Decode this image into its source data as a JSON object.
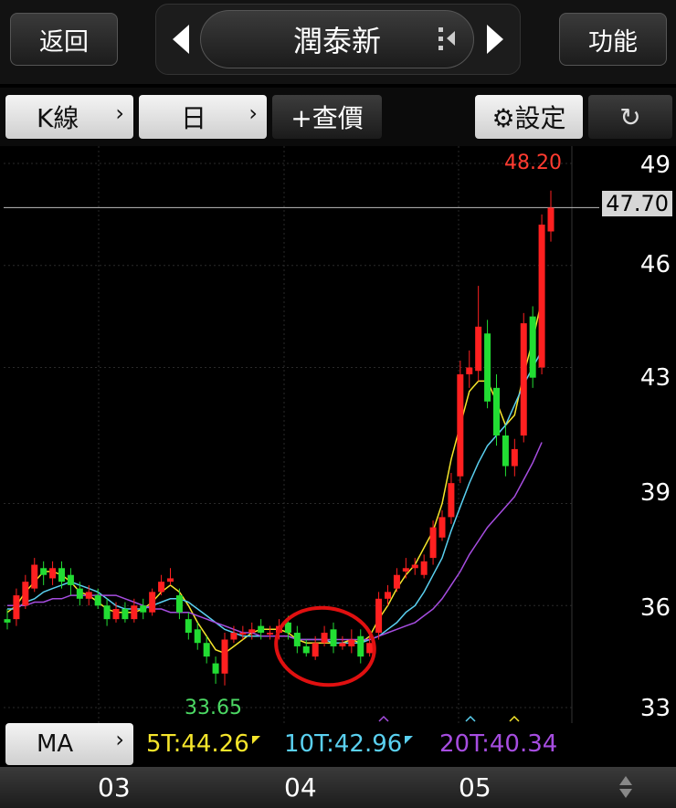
{
  "header": {
    "back_label": "返回",
    "title": "潤泰新",
    "menu_label": "功能"
  },
  "toolbar": {
    "chart_type_label": "K線",
    "period_label": "日",
    "lookup_label": "+查價",
    "settings_label": "⚙設定"
  },
  "chart_data": {
    "type": "candlestick",
    "y_ticks": [
      "49",
      "46",
      "43",
      "39",
      "36",
      "33"
    ],
    "ylim": [
      32.5,
      49.5
    ],
    "x_ticks": [
      "03",
      "04",
      "05"
    ],
    "max_label": "48.20",
    "min_label": "33.65",
    "current_price": "47.70",
    "candles": [
      {
        "o": 35.6,
        "c": 35.5,
        "h": 35.9,
        "l": 35.3
      },
      {
        "o": 35.6,
        "c": 36.3,
        "h": 36.5,
        "l": 35.4
      },
      {
        "o": 36.0,
        "c": 36.7,
        "h": 36.9,
        "l": 35.9
      },
      {
        "o": 36.5,
        "c": 37.2,
        "h": 37.4,
        "l": 36.4
      },
      {
        "o": 37.1,
        "c": 36.9,
        "h": 37.3,
        "l": 36.6
      },
      {
        "o": 36.8,
        "c": 37.1,
        "h": 37.3,
        "l": 36.6
      },
      {
        "o": 37.1,
        "c": 36.7,
        "h": 37.3,
        "l": 36.5
      },
      {
        "o": 36.9,
        "c": 36.6,
        "h": 37.1,
        "l": 36.3
      },
      {
        "o": 36.5,
        "c": 36.2,
        "h": 36.7,
        "l": 36.0
      },
      {
        "o": 36.2,
        "c": 36.4,
        "h": 36.6,
        "l": 36.0
      },
      {
        "o": 36.3,
        "c": 36.0,
        "h": 36.5,
        "l": 35.9
      },
      {
        "o": 36.0,
        "c": 35.6,
        "h": 36.2,
        "l": 35.4
      },
      {
        "o": 35.6,
        "c": 35.9,
        "h": 36.1,
        "l": 35.5
      },
      {
        "o": 35.9,
        "c": 35.6,
        "h": 36.1,
        "l": 35.5
      },
      {
        "o": 35.6,
        "c": 36.0,
        "h": 36.2,
        "l": 35.5
      },
      {
        "o": 36.0,
        "c": 35.8,
        "h": 36.2,
        "l": 35.6
      },
      {
        "o": 35.8,
        "c": 36.4,
        "h": 36.5,
        "l": 35.7
      },
      {
        "o": 36.4,
        "c": 36.7,
        "h": 36.9,
        "l": 36.3
      },
      {
        "o": 36.7,
        "c": 36.8,
        "h": 37.1,
        "l": 36.6
      },
      {
        "o": 36.3,
        "c": 35.8,
        "h": 36.5,
        "l": 35.6
      },
      {
        "o": 35.6,
        "c": 35.2,
        "h": 35.8,
        "l": 35.0
      },
      {
        "o": 35.3,
        "c": 34.9,
        "h": 35.5,
        "l": 34.7
      },
      {
        "o": 34.9,
        "c": 34.5,
        "h": 35.1,
        "l": 34.3
      },
      {
        "o": 34.3,
        "c": 34.0,
        "h": 34.5,
        "l": 33.7
      },
      {
        "o": 34.0,
        "c": 35.0,
        "h": 35.2,
        "l": 33.65
      },
      {
        "o": 35.0,
        "c": 35.2,
        "h": 35.4,
        "l": 34.9
      },
      {
        "o": 35.2,
        "c": 35.2,
        "h": 35.4,
        "l": 35.0
      },
      {
        "o": 35.2,
        "c": 35.3,
        "h": 35.5,
        "l": 35.0
      },
      {
        "o": 35.4,
        "c": 35.2,
        "h": 35.6,
        "l": 35.0
      },
      {
        "o": 35.2,
        "c": 35.2,
        "h": 35.4,
        "l": 35.0
      },
      {
        "o": 35.2,
        "c": 35.4,
        "h": 35.6,
        "l": 35.0
      },
      {
        "o": 35.5,
        "c": 35.2,
        "h": 35.7,
        "l": 35.0
      },
      {
        "o": 35.2,
        "c": 34.8,
        "h": 35.4,
        "l": 34.6
      },
      {
        "o": 34.8,
        "c": 34.6,
        "h": 35.0,
        "l": 34.5
      },
      {
        "o": 34.5,
        "c": 34.9,
        "h": 35.1,
        "l": 34.4
      },
      {
        "o": 34.9,
        "c": 35.2,
        "h": 35.4,
        "l": 34.8
      },
      {
        "o": 35.3,
        "c": 34.8,
        "h": 35.5,
        "l": 34.6
      },
      {
        "o": 34.8,
        "c": 34.9,
        "h": 35.1,
        "l": 34.7
      },
      {
        "o": 34.8,
        "c": 35.0,
        "h": 35.3,
        "l": 34.6
      },
      {
        "o": 35.1,
        "c": 34.5,
        "h": 35.3,
        "l": 34.3
      },
      {
        "o": 34.6,
        "c": 34.9,
        "h": 35.2,
        "l": 34.5
      },
      {
        "o": 35.2,
        "c": 36.2,
        "h": 36.4,
        "l": 35.0
      },
      {
        "o": 36.2,
        "c": 36.4,
        "h": 36.6,
        "l": 36.0
      },
      {
        "o": 36.5,
        "c": 36.9,
        "h": 37.1,
        "l": 36.4
      },
      {
        "o": 37.0,
        "c": 37.1,
        "h": 37.4,
        "l": 36.8
      },
      {
        "o": 37.1,
        "c": 37.2,
        "h": 37.4,
        "l": 36.9
      },
      {
        "o": 36.9,
        "c": 37.3,
        "h": 37.5,
        "l": 36.8
      },
      {
        "o": 37.4,
        "c": 38.3,
        "h": 38.5,
        "l": 37.2
      },
      {
        "o": 38.0,
        "c": 38.6,
        "h": 38.8,
        "l": 37.9
      },
      {
        "o": 38.6,
        "c": 39.6,
        "h": 39.9,
        "l": 38.4
      },
      {
        "o": 39.8,
        "c": 42.8,
        "h": 43.2,
        "l": 39.6
      },
      {
        "o": 42.8,
        "c": 43.0,
        "h": 43.5,
        "l": 42.4
      },
      {
        "o": 42.9,
        "c": 44.2,
        "h": 45.4,
        "l": 42.6
      },
      {
        "o": 44.0,
        "c": 42.0,
        "h": 44.4,
        "l": 41.8
      },
      {
        "o": 42.4,
        "c": 41.0,
        "h": 42.8,
        "l": 40.7
      },
      {
        "o": 41.0,
        "c": 40.1,
        "h": 41.3,
        "l": 39.8
      },
      {
        "o": 40.1,
        "c": 40.6,
        "h": 40.9,
        "l": 39.8
      },
      {
        "o": 41.0,
        "c": 44.3,
        "h": 44.6,
        "l": 40.8
      },
      {
        "o": 44.5,
        "c": 42.7,
        "h": 44.8,
        "l": 42.4
      },
      {
        "o": 43.0,
        "c": 47.2,
        "h": 47.5,
        "l": 42.8
      },
      {
        "o": 47.0,
        "c": 47.7,
        "h": 48.2,
        "l": 46.7
      }
    ],
    "ma_lines": [
      {
        "name": "5T",
        "color": "#f5e52b",
        "values": [
          35.8,
          36.0,
          36.4,
          36.7,
          37.0,
          37.0,
          36.9,
          36.7,
          36.4,
          36.3,
          36.1,
          35.9,
          35.8,
          35.8,
          35.8,
          35.9,
          36.1,
          36.4,
          36.6,
          36.4,
          36.0,
          35.5,
          35.1,
          34.7,
          34.6,
          34.8,
          35.0,
          35.2,
          35.3,
          35.3,
          35.3,
          35.2,
          35.0,
          34.9,
          34.9,
          34.9,
          34.9,
          34.9,
          35.0,
          34.9,
          35.1,
          35.6,
          36.0,
          36.5,
          36.9,
          37.2,
          37.7,
          38.2,
          39.0,
          40.3,
          41.3,
          42.3,
          42.6,
          42.6,
          42.0,
          41.3,
          41.6,
          42.8,
          43.8,
          45.0
        ]
      },
      {
        "name": "10T",
        "color": "#5ad0f0",
        "values": [
          35.9,
          35.9,
          36.1,
          36.2,
          36.4,
          36.5,
          36.6,
          36.7,
          36.6,
          36.5,
          36.4,
          36.2,
          36.0,
          35.9,
          35.9,
          35.9,
          36.0,
          36.1,
          36.2,
          36.2,
          36.1,
          35.9,
          35.7,
          35.5,
          35.3,
          35.2,
          35.1,
          35.1,
          35.1,
          35.1,
          35.1,
          35.1,
          35.0,
          35.0,
          35.0,
          35.0,
          34.9,
          34.9,
          34.9,
          34.9,
          35.0,
          35.1,
          35.3,
          35.5,
          35.8,
          36.0,
          36.4,
          36.9,
          37.4,
          38.2,
          38.9,
          39.6,
          40.2,
          40.7,
          41.0,
          41.3,
          41.9,
          42.5,
          43.0,
          43.5
        ]
      },
      {
        "name": "20T",
        "color": "#a64de0",
        "values": [
          36.0,
          36.0,
          36.0,
          36.1,
          36.1,
          36.2,
          36.2,
          36.3,
          36.3,
          36.3,
          36.3,
          36.3,
          36.3,
          36.2,
          36.1,
          36.0,
          35.9,
          35.9,
          35.8,
          35.8,
          35.8,
          35.7,
          35.6,
          35.5,
          35.4,
          35.3,
          35.2,
          35.2,
          35.1,
          35.1,
          35.1,
          35.1,
          35.0,
          35.0,
          35.0,
          35.0,
          35.0,
          35.0,
          35.0,
          35.0,
          35.0,
          35.1,
          35.2,
          35.3,
          35.4,
          35.5,
          35.7,
          35.9,
          36.2,
          36.6,
          37.0,
          37.5,
          37.9,
          38.3,
          38.6,
          38.9,
          39.2,
          39.7,
          40.2,
          40.8
        ]
      }
    ]
  },
  "ma_bar": {
    "label": "MA",
    "items": [
      {
        "text": "5T:44.26",
        "color": "#f5e52b"
      },
      {
        "text": "10T:42.96",
        "color": "#5ad0f0"
      },
      {
        "text": "20T:40.34",
        "color": "#a64de0"
      }
    ]
  }
}
